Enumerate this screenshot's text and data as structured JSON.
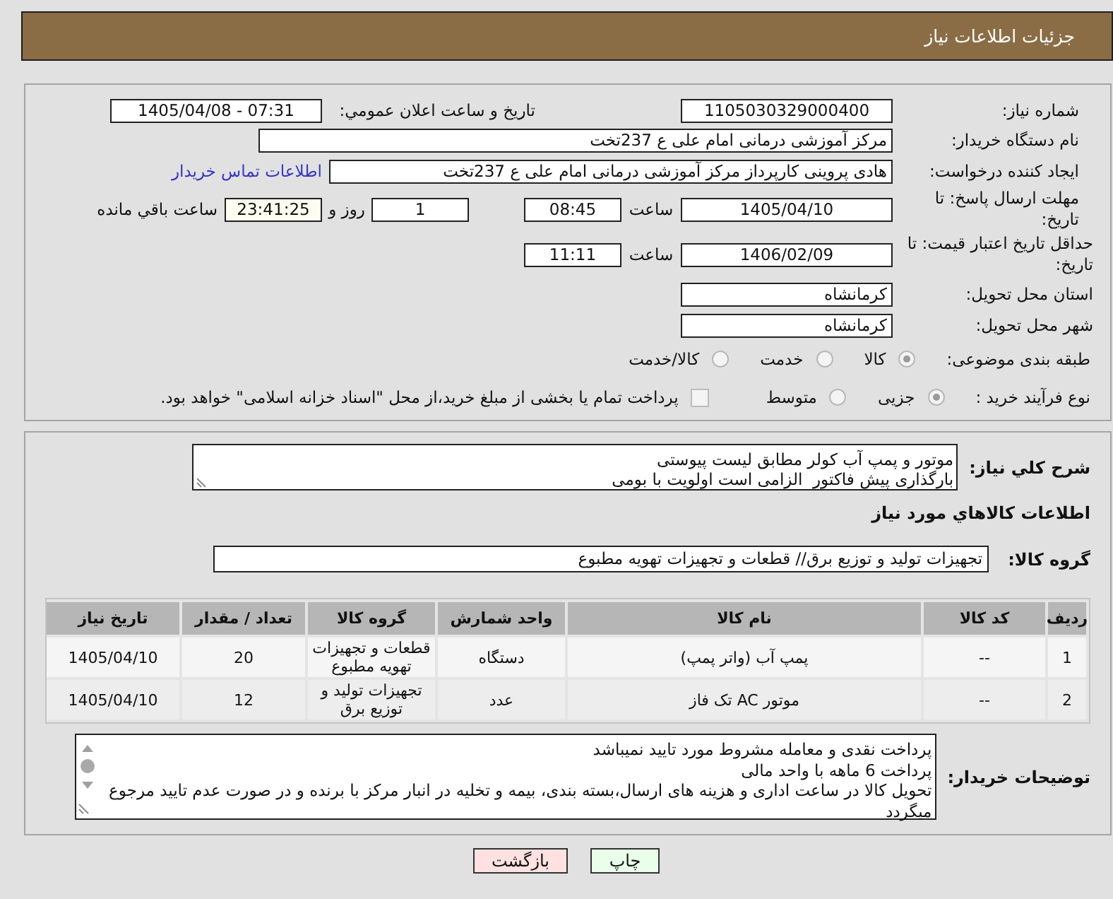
{
  "header": {
    "title": "جزئیات اطلاعات نیاز"
  },
  "details": {
    "need_number": {
      "label": "شماره نیاز:",
      "value": "1105030329000400"
    },
    "announce": {
      "label": "تاریخ و ساعت اعلان عمومي:",
      "value": "1405/04/08 - 07:31"
    },
    "buyer_org": {
      "label": "نام دستگاه خریدار:",
      "value": "مرکز آموزشی درمانی امام علی ع 237تخت"
    },
    "requester": {
      "label": "ایجاد کننده درخواست:",
      "value": "هادی پروینی کارپرداز  مرکز آموزشی درمانی امام علی ع 237تخت",
      "link": "اطلاعات تماس خریدار"
    },
    "reply_deadline": {
      "label": "مهلت ارسال پاسخ: تا تاریخ:",
      "date": "1405/04/10",
      "time_label": "ساعت",
      "time": "08:45",
      "days": "1",
      "days_label": "روز و",
      "remaining": "23:41:25",
      "remaining_label": "ساعت باقي مانده"
    },
    "price_validity": {
      "label": "حداقل تاریخ اعتبار قیمت: تا تاریخ:",
      "date": "1406/02/09",
      "time_label": "ساعت",
      "time": "11:11"
    },
    "province": {
      "label": "استان محل تحویل:",
      "value": "کرمانشاه"
    },
    "city": {
      "label": "شهر محل تحویل:",
      "value": "کرمانشاه"
    },
    "category": {
      "label": "طبقه بندی موضوعی:",
      "options": [
        {
          "label": "کالا",
          "selected": true
        },
        {
          "label": "خدمت",
          "selected": false
        },
        {
          "label": "کالا/خدمت",
          "selected": false
        }
      ]
    },
    "process": {
      "label": "نوع فرآیند خرید :",
      "options": [
        {
          "label": "جزیی",
          "selected": true
        },
        {
          "label": "متوسط",
          "selected": false
        }
      ],
      "treasury": {
        "label": "پرداخت تمام یا بخشی از مبلغ خرید،از محل \"اسناد خزانه اسلامی\" خواهد بود.",
        "checked": false
      }
    }
  },
  "need": {
    "description": {
      "label": "شرح کلي نیاز:",
      "lines": [
        "موتور و پمپ آب کولر مطابق لیست پیوستی",
        "بارگذاری پیش فاکتور  الزامی است اولویت با بومی"
      ]
    },
    "goods_heading": "اطلاعات کالاهاي مورد نیاز",
    "goods_group": {
      "label": "گروه کالا:",
      "value": "تجهیزات تولید و توزیع برق//  قطعات و تجهیزات تهویه مطبوع"
    },
    "table": {
      "columns": [
        "ردیف",
        "کد کالا",
        "نام کالا",
        "واحد شمارش",
        "گروه کالا",
        "تعداد / مقدار",
        "تاریخ نیاز"
      ],
      "rows": [
        [
          "1",
          "--",
          "پمپ آب (واتر پمپ)",
          "دستگاه",
          "قطعات و تجهیزات تهویه مطبوع",
          "20",
          "1405/04/10"
        ],
        [
          "2",
          "--",
          "موتور AC تک فاز",
          "عدد",
          "تجهیزات تولید و توزیع برق",
          "12",
          "1405/04/10"
        ]
      ]
    },
    "buyer_notes": {
      "label": "توضیحات خریدار:",
      "lines": [
        "پرداخت نقدی و معامله مشروط مورد تایید نمیباشد",
        "پرداخت 6 ماهه با واحد مالی",
        "تحویل کالا در ساعت اداری و هزینه های ارسال،بسته بندی، بیمه و تخلیه در انبار مرکز با برنده و در صورت عدم تایید مرجوع میگردد"
      ]
    }
  },
  "buttons": [
    {
      "label": "چاپ",
      "color": "#eaffea"
    },
    {
      "label": "بازگشت",
      "color": "#ffe1e1"
    }
  ]
}
